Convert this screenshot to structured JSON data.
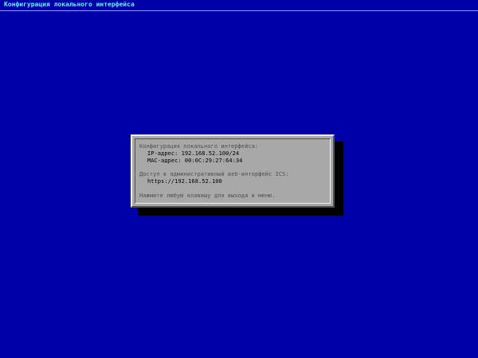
{
  "header": {
    "title": "Конфигурация локального интерфейса"
  },
  "dialog": {
    "section_interface": "Конфигурация локального интерфейса:",
    "ip_label": "IP-адрес:",
    "ip_value": "192.168.52.100/24",
    "mac_label": "MAC-адрес:",
    "mac_value": "00:0C:29:27:64:34",
    "section_access": "Доступ в административный веб-интерфейс ICS:",
    "url": "https://192.168.52.100",
    "hint": "Нажмите любую клавишу для выхода в меню."
  },
  "colors": {
    "background": "#0000a8",
    "title_text": "#5ff5f5",
    "dialog_face": "#a8a8a8",
    "dialog_text_muted": "#505050",
    "dialog_text_value": "#000000",
    "shadow": "#000000"
  }
}
